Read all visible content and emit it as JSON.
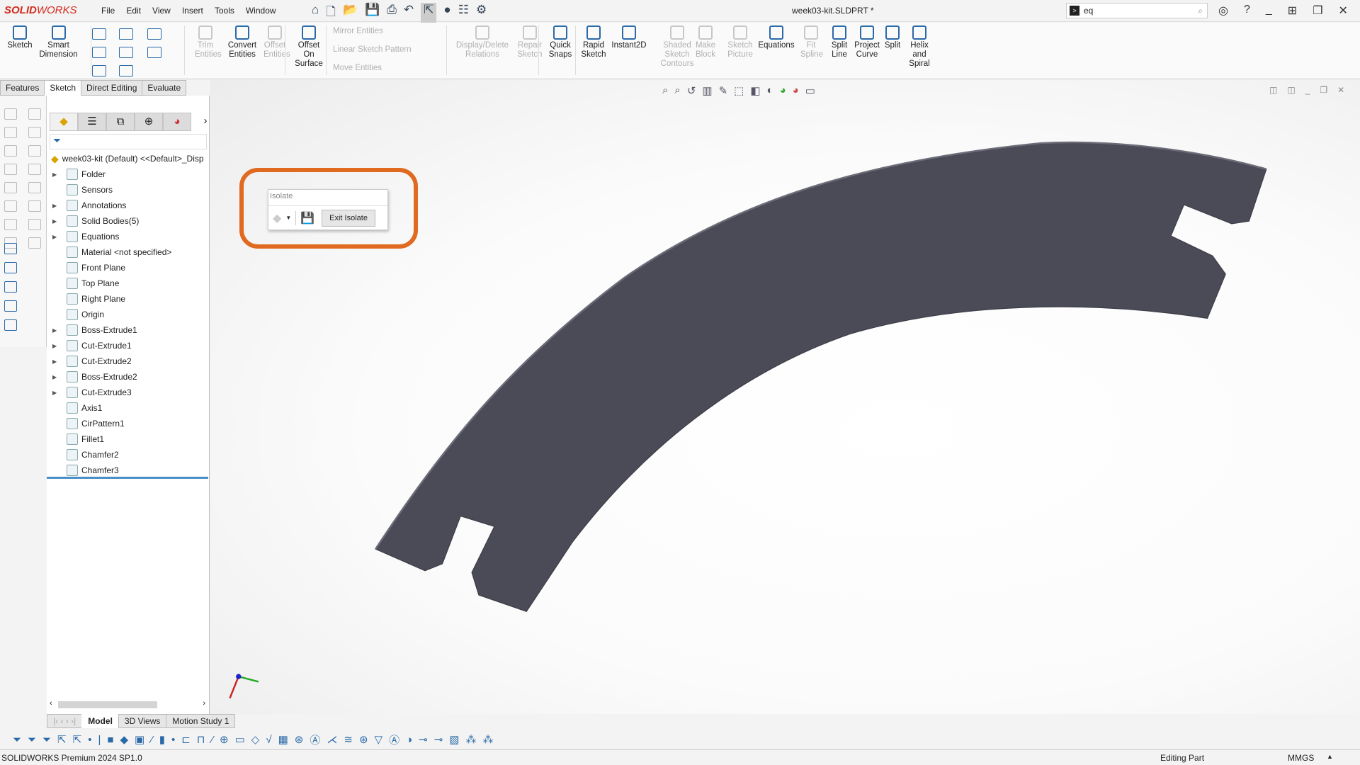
{
  "app": {
    "brand_bold": "SOLID",
    "brand": "WORKS",
    "document_title": "week03-kit.SLDPRT *"
  },
  "menu": [
    "File",
    "Edit",
    "View",
    "Insert",
    "Tools",
    "Window"
  ],
  "search": {
    "value": "eq"
  },
  "ribbon": {
    "big": [
      {
        "label": "Sketch",
        "disabled": false
      },
      {
        "label": "Smart Dimension",
        "disabled": false
      },
      {
        "label": "Trim Entities",
        "disabled": true
      },
      {
        "label": "Convert Entities",
        "disabled": false
      },
      {
        "label": "Offset Entities",
        "disabled": true
      },
      {
        "label": "Offset On Surface",
        "disabled": false
      },
      {
        "label": "Display/Delete Relations",
        "disabled": true
      },
      {
        "label": "Repair Sketch",
        "disabled": true
      },
      {
        "label": "Quick Snaps",
        "disabled": false
      },
      {
        "label": "Rapid Sketch",
        "disabled": false
      },
      {
        "label": "Instant2D",
        "disabled": false
      },
      {
        "label": "Shaded Sketch Contours",
        "disabled": true
      },
      {
        "label": "Make Block",
        "disabled": true
      },
      {
        "label": "Sketch Picture",
        "disabled": true
      },
      {
        "label": "Equations",
        "disabled": false
      },
      {
        "label": "Fit Spline",
        "disabled": true
      },
      {
        "label": "Split Line",
        "disabled": false
      },
      {
        "label": "Project Curve",
        "disabled": false
      },
      {
        "label": "Split",
        "disabled": false
      },
      {
        "label": "Helix and Spiral",
        "disabled": false
      }
    ],
    "small": [
      "Mirror Entities",
      "Linear Sketch Pattern",
      "Move Entities"
    ]
  },
  "command_tabs": [
    {
      "label": "Features"
    },
    {
      "label": "Sketch",
      "active": true
    },
    {
      "label": "Direct Editing"
    },
    {
      "label": "Evaluate"
    }
  ],
  "tree": {
    "root": "week03-kit (Default) <<Default>_Disp",
    "items": [
      {
        "label": "Folder",
        "expand": true
      },
      {
        "label": "Sensors",
        "expand": false
      },
      {
        "label": "Annotations",
        "expand": true
      },
      {
        "label": "Solid Bodies(5)",
        "expand": true
      },
      {
        "label": "Equations",
        "expand": true
      },
      {
        "label": "Material <not specified>",
        "expand": false
      },
      {
        "label": "Front Plane",
        "expand": false
      },
      {
        "label": "Top Plane",
        "expand": false
      },
      {
        "label": "Right Plane",
        "expand": false
      },
      {
        "label": "Origin",
        "expand": false
      },
      {
        "label": "Boss-Extrude1",
        "expand": true
      },
      {
        "label": "Cut-Extrude1",
        "expand": true
      },
      {
        "label": "Cut-Extrude2",
        "expand": true
      },
      {
        "label": "Boss-Extrude2",
        "expand": true
      },
      {
        "label": "Cut-Extrude3",
        "expand": true
      },
      {
        "label": "Axis1",
        "expand": false
      },
      {
        "label": "CirPattern1",
        "expand": false
      },
      {
        "label": "Fillet1",
        "expand": false
      },
      {
        "label": "Chamfer2",
        "expand": false
      },
      {
        "label": "Chamfer3",
        "expand": false
      }
    ]
  },
  "isolate": {
    "title": "Isolate",
    "exit_label": "Exit Isolate",
    "highlight_color": "#e06a1f"
  },
  "bottom_tabs": [
    {
      "label": "Model",
      "active": true
    },
    {
      "label": "3D Views"
    },
    {
      "label": "Motion Study 1"
    }
  ],
  "status": {
    "product": "SOLIDWORKS Premium 2024 SP1.0",
    "mode": "Editing Part",
    "units": "MMGS"
  },
  "colors": {
    "part_face": "#4a4b57",
    "accent": "#2a6aa8"
  }
}
